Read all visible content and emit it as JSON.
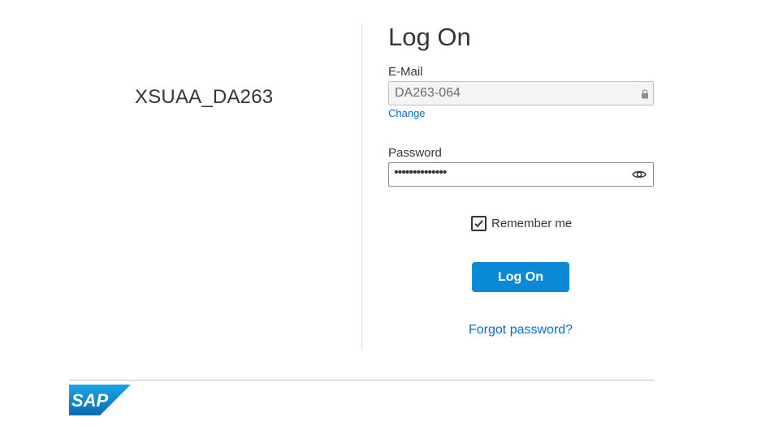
{
  "tenant": {
    "name": "XSUAA_DA263"
  },
  "form": {
    "title": "Log On",
    "email": {
      "label": "E-Mail",
      "value": "DA263-064",
      "change_link": "Change"
    },
    "password": {
      "label": "Password",
      "masked_value": "••••••••••••••"
    },
    "remember": {
      "label": "Remember me",
      "checked": true
    },
    "submit_label": "Log On",
    "forgot_link": "Forgot password?"
  },
  "footer": {
    "logo_text": "SAP"
  },
  "colors": {
    "accent": "#0a8ad6",
    "link": "#0a6ed1",
    "logo_blue": "#1a7cc2"
  }
}
